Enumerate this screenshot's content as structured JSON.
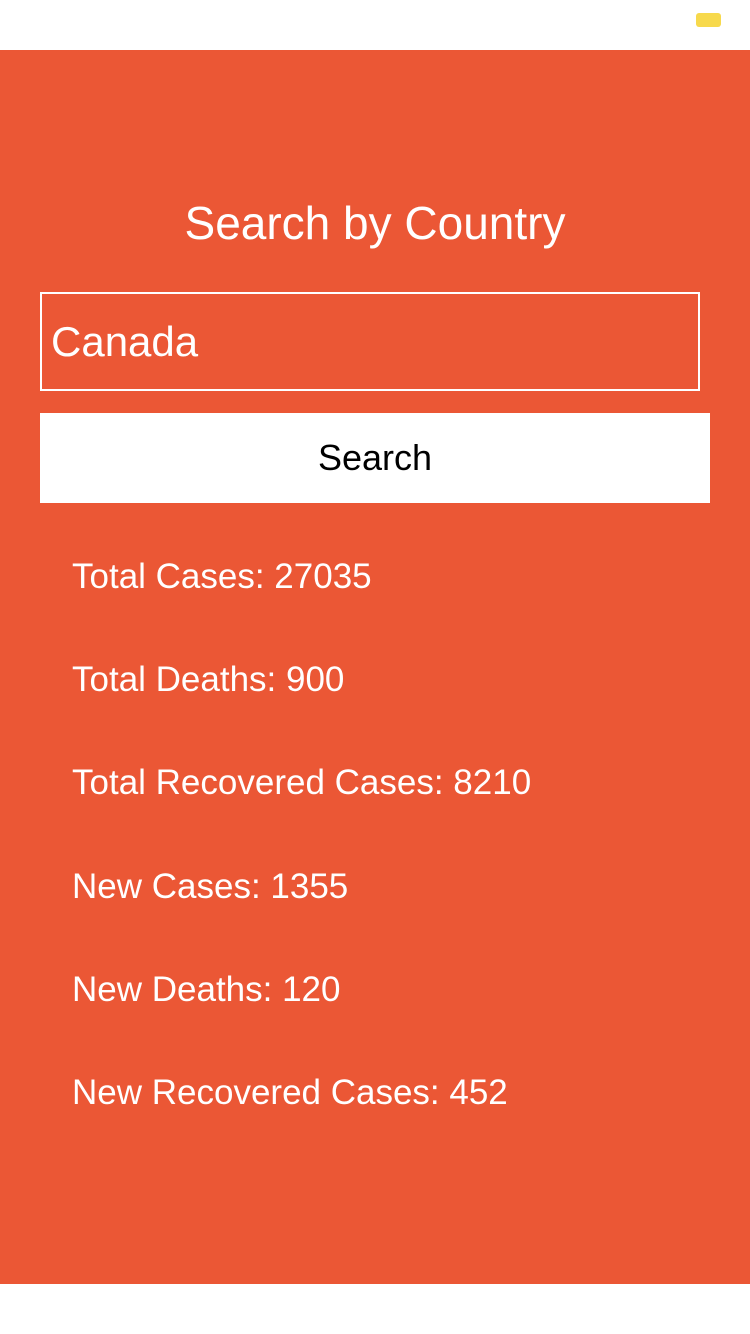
{
  "colors": {
    "panel_background": "#EB5735",
    "battery_indicator": "#F7D94C",
    "text": "#FFFFFF",
    "button_background": "#FFFFFF",
    "button_text": "#000000"
  },
  "status_bar": {
    "battery_icon": "battery-icon"
  },
  "page": {
    "title": "Search by Country"
  },
  "search": {
    "value": "Canada",
    "button_label": "Search"
  },
  "stats": [
    "Total Cases: 27035",
    "Total Deaths: 900",
    "Total Recovered Cases: 8210",
    "New Cases: 1355",
    "New Deaths: 120",
    "New Recovered Cases: 452"
  ]
}
